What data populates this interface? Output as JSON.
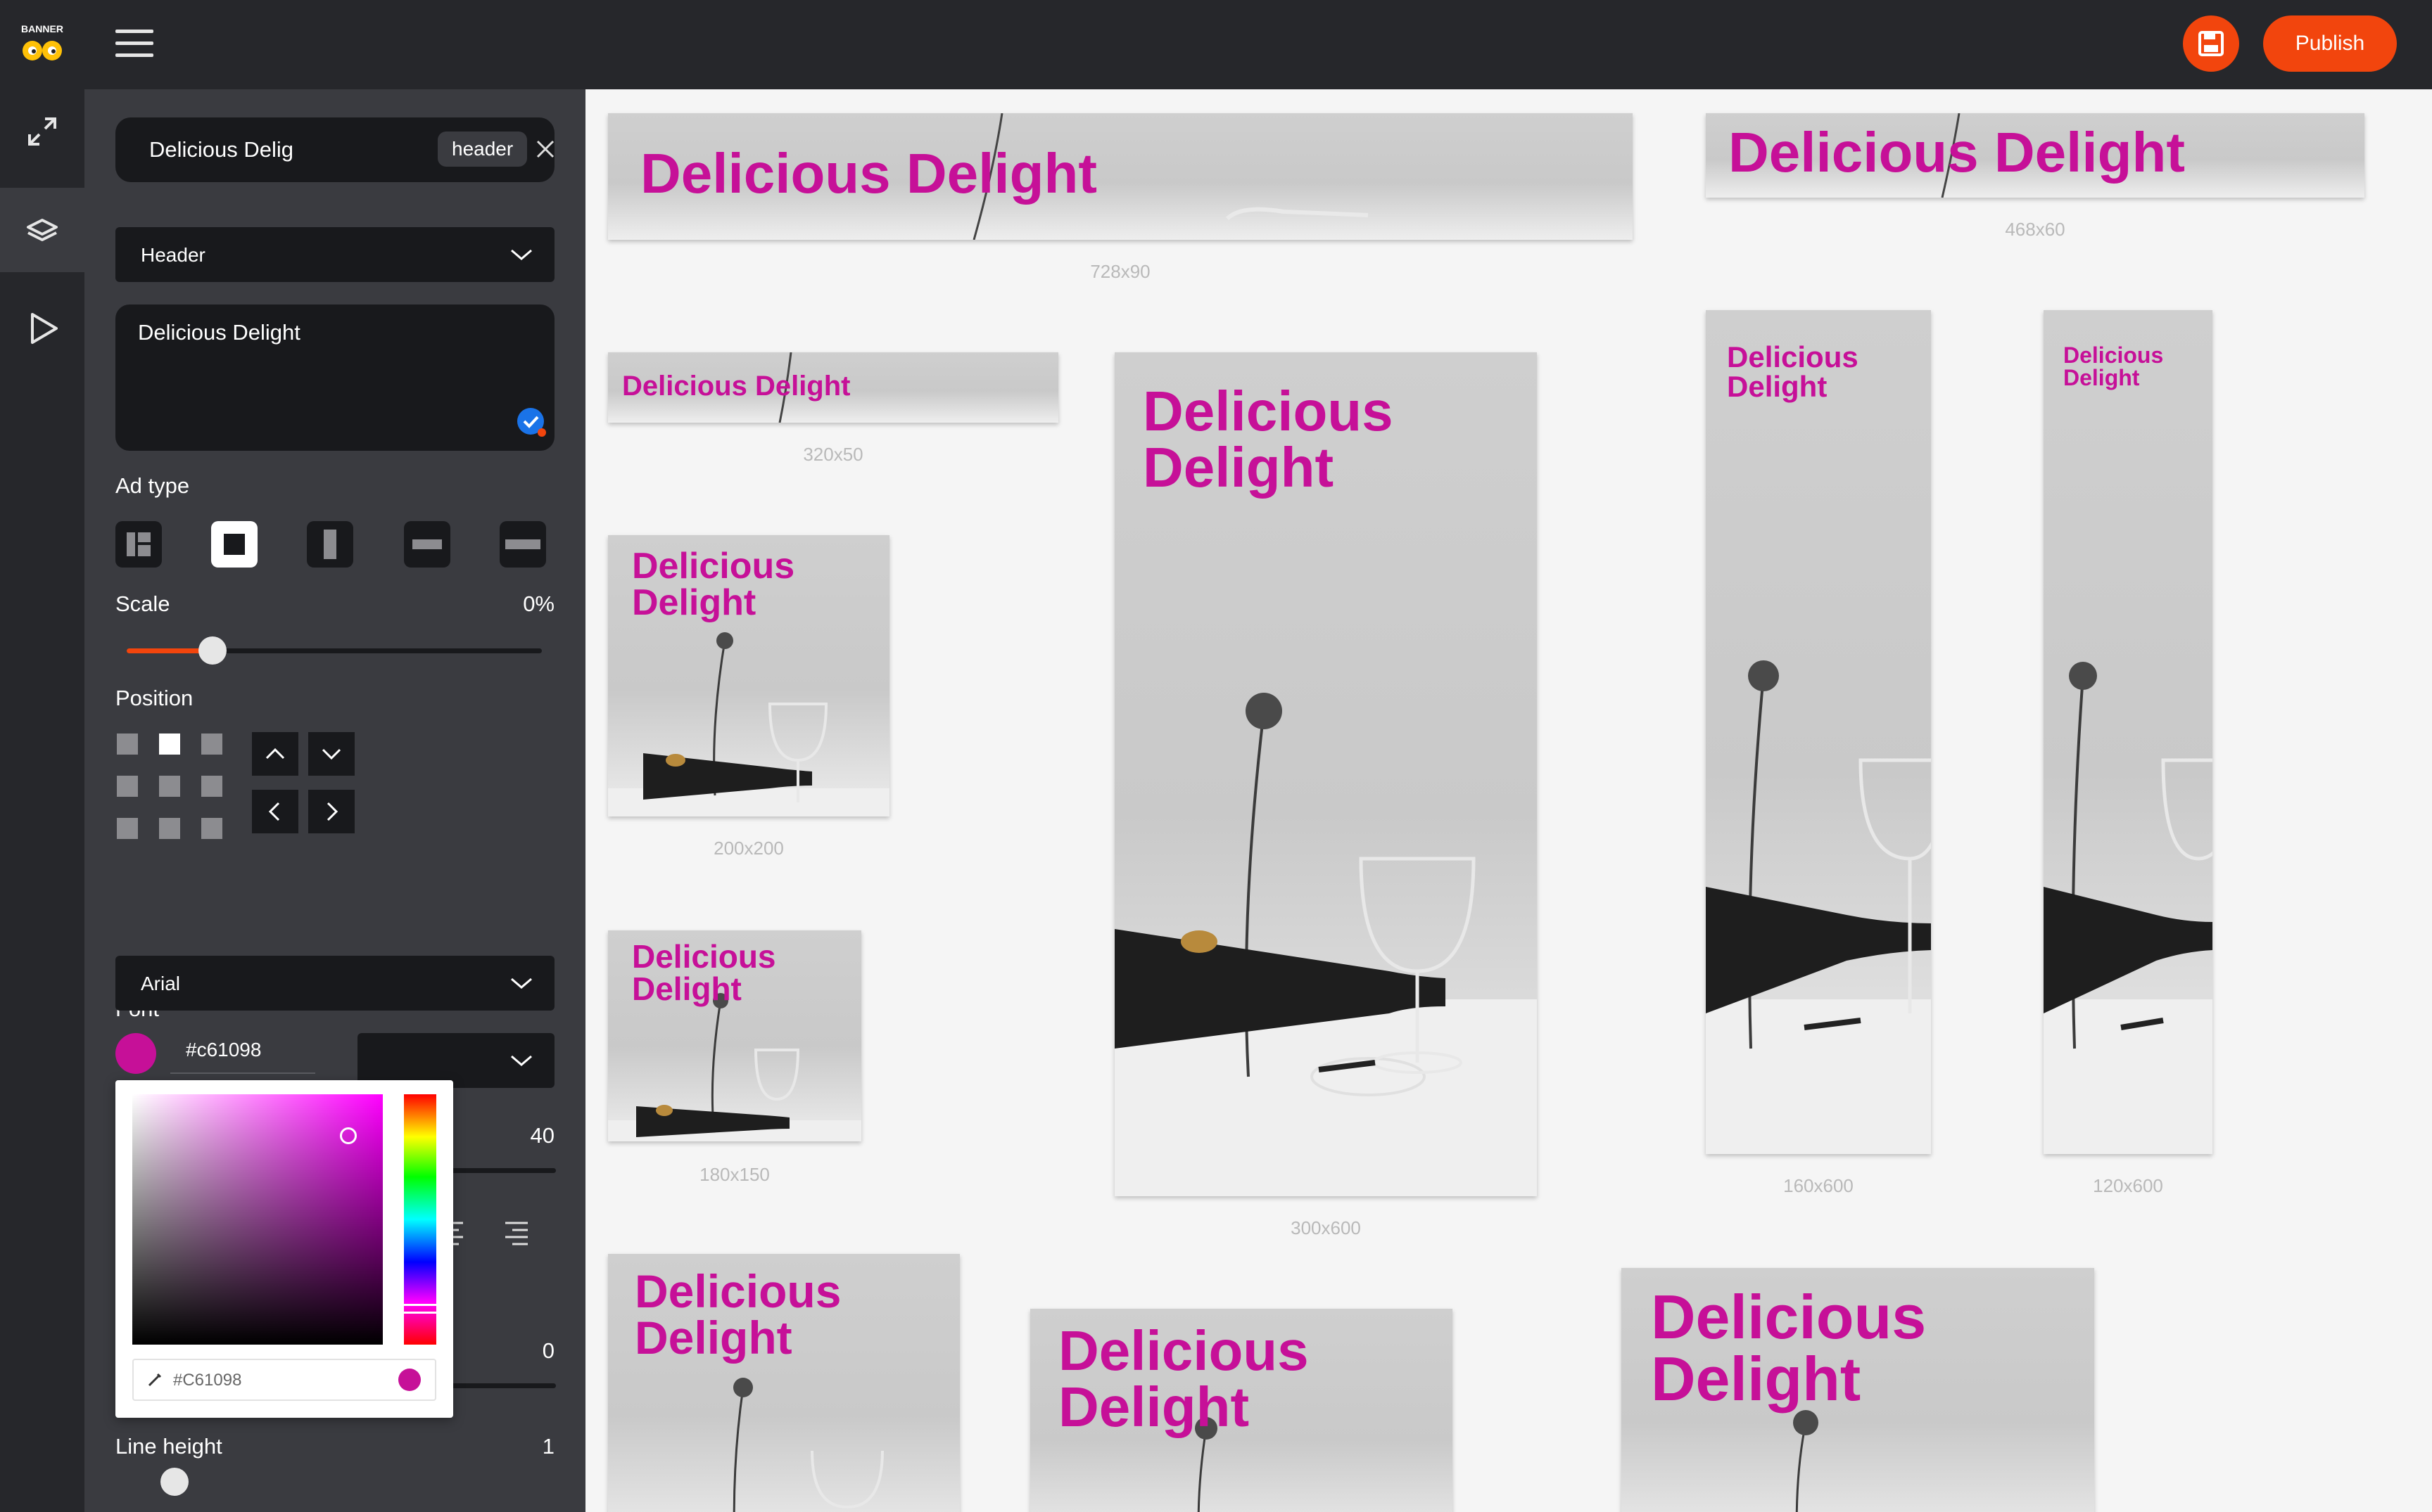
{
  "topbar": {
    "logo_text": "BANNER BOO",
    "publish_label": "Publish"
  },
  "panel": {
    "layer_name": "Delicious Delig",
    "layer_tag": "header",
    "element_type": "Header",
    "text_value": "Delicious Delight",
    "ad_type_label": "Ad type",
    "scale_label": "Scale",
    "scale_value": "0%",
    "position_label": "Position",
    "font_label": "Font",
    "font_value": "Arial",
    "color_hex": "#c61098",
    "font_size_value": "40",
    "spacing_value": "0",
    "line_height_label": "Line height",
    "line_height_value": "1"
  },
  "picker": {
    "hex_value": "#C61098"
  },
  "banners": {
    "b728": {
      "headline": "Delicious Delight",
      "size": "728x90"
    },
    "b468": {
      "headline": "Delicious Delight",
      "size": "468x60"
    },
    "b320": {
      "headline": "Delicious Delight",
      "size": "320x50"
    },
    "b300": {
      "headline": "Delicious\nDelight",
      "size": "300x600"
    },
    "b160": {
      "headline": "Delicious\nDelight",
      "size": "160x600"
    },
    "b120": {
      "headline": "Delicious\nDelight",
      "size": "120x600"
    },
    "b200": {
      "headline": "Delicious\nDelight",
      "size": "200x200"
    },
    "b180": {
      "headline": "Delicious\nDelight",
      "size": "180x150"
    },
    "b250a": {
      "headline": "Delicious\nDelight"
    },
    "b300b": {
      "headline": "Delicious\nDelight"
    },
    "b336": {
      "headline": "Delicious\nDelight"
    }
  },
  "colors": {
    "accent": "#f2450d",
    "headline": "#c61098",
    "dark_bg": "#26272b",
    "panel_bg": "#3a3b40"
  }
}
